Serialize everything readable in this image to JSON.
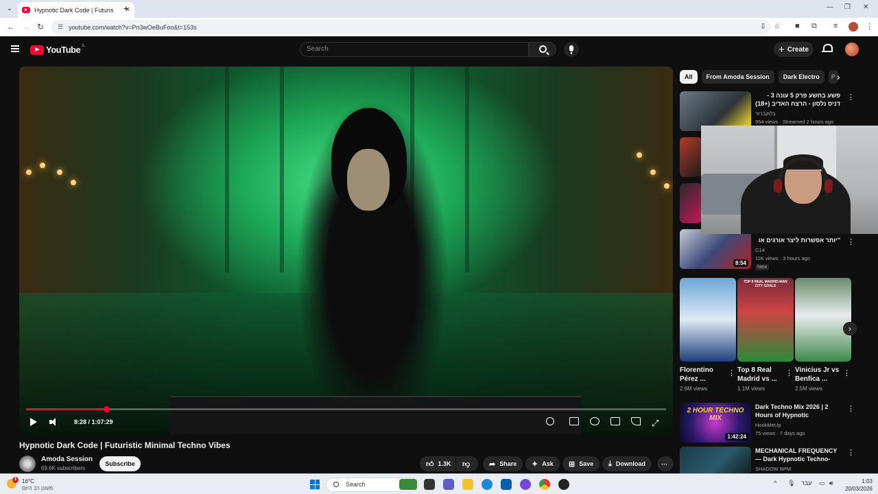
{
  "browser": {
    "tab_title": "Hypnotic Dark Code | Futuristic",
    "url": "youtube.com/watch?v=Pn3wOeBuFoo&t=153s"
  },
  "youtube": {
    "logo_text": "YouTube",
    "country_code": "IL",
    "search_placeholder": "Search",
    "create_label": "Create"
  },
  "player": {
    "time_current": "8:28",
    "time_total": "1:07:29",
    "time_display": "8:28 / 1:07:29",
    "progress_fraction": 0.125
  },
  "video": {
    "title": "Hypnotic Dark Code | Futuristic Minimal Techno Vibes",
    "channel_name": "Amoda Session",
    "subscribers": "69.6K subscribers",
    "subscribe_label": "Subscribe",
    "likes": "1.3K",
    "share_label": "Share",
    "ask_label": "Ask",
    "save_label": "Save",
    "download_label": "Download"
  },
  "chips": [
    "All",
    "From Amoda Session",
    "Dark Electro",
    "P"
  ],
  "recommendations": [
    {
      "title": "פשע בחשע פרק 5 עונה 3 - דניס נלסון - הרצח האדיב (+18)",
      "channel": "בלוקברזר",
      "views": "954 views · Streamed 2 hours ago",
      "duration": ""
    },
    {
      "title": "\"יותר אפשרות ליצר אורגים או טילים\"",
      "channel": "C14",
      "views": "11K views · 3 hours ago",
      "badge": "New",
      "duration": "8:54"
    },
    {
      "title": "Dark Techno Mix 2026 | 2 Hours of Hypnotic Underground ...",
      "channel": "HookMeUp",
      "views": "75 views · 7 days ago",
      "duration": "1:42:24",
      "thumb_text": "2 HOUR TECHNO MIX"
    },
    {
      "title": "MECHANICAL FREQUENCY — Dark Hypnotic Techno-House ...",
      "channel": "SHADOW BPM",
      "views": "",
      "duration": ""
    }
  ],
  "shorts": [
    {
      "title": "Florentino Pérez ...",
      "views": "2.6M views"
    },
    {
      "title": "Top 8 Real Madrid vs ...",
      "views": "1.1M views",
      "thumb_text": "TOP 8 REAL MADRID-MAN CITY GOALS"
    },
    {
      "title": "Vinicius Jr vs Benfica ...",
      "views": "2.5M views"
    }
  ],
  "taskbar": {
    "temperature": "16°C",
    "weather_text": "מעונן רב היום",
    "notification_count": "1",
    "search_label": "Search",
    "language": "עבר",
    "time": "1:03",
    "date": "20/03/2026"
  },
  "colors": {
    "youtube_red": "#ff0033",
    "bg": "#0f0f0f",
    "chip_bg": "#272727"
  }
}
